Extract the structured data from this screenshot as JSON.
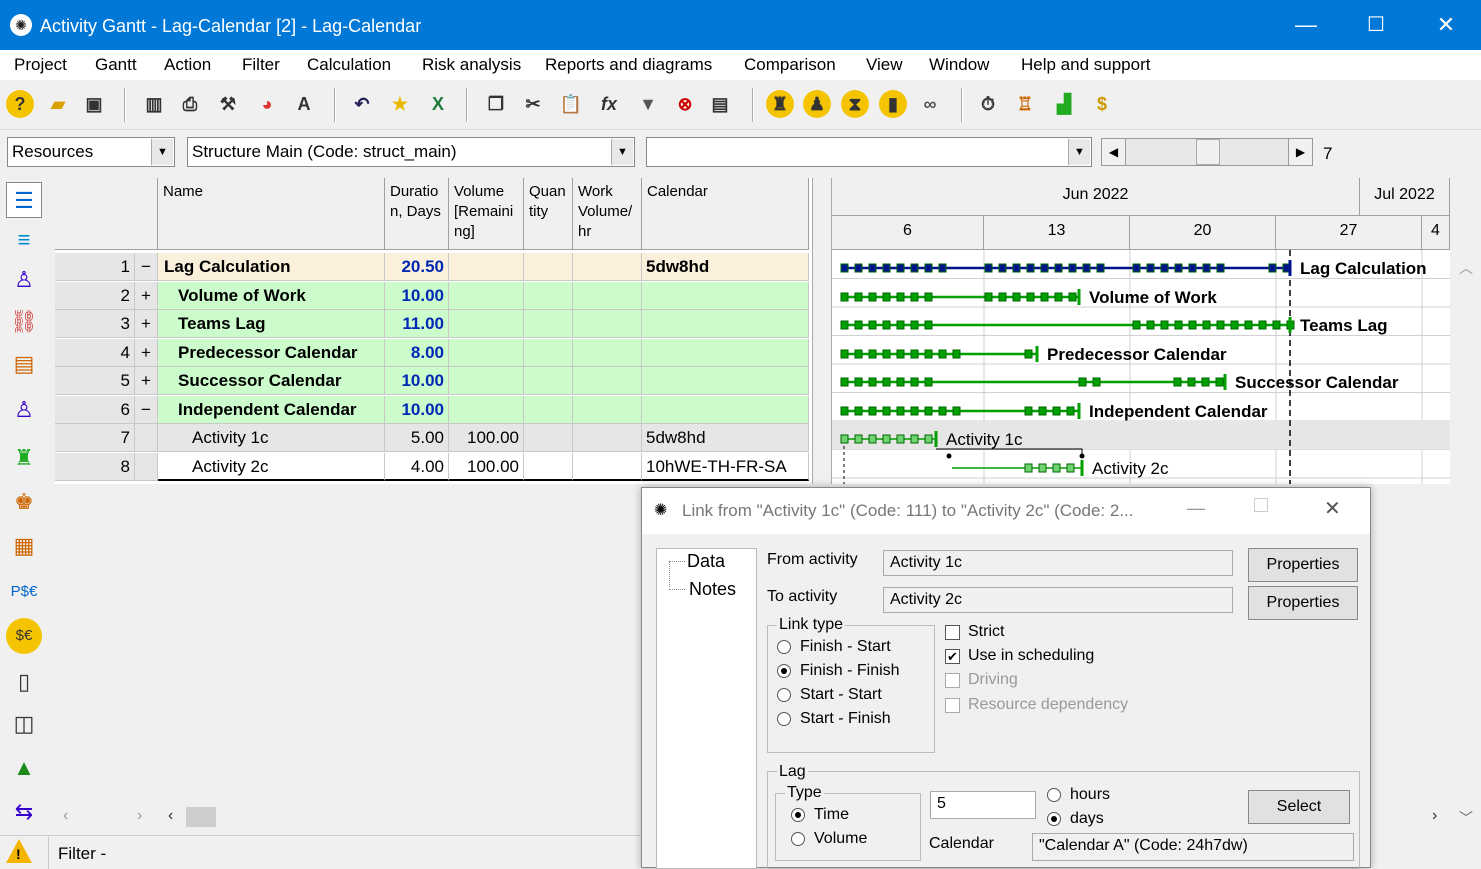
{
  "window": {
    "title": "Activity Gantt - Lag-Calendar [2] - Lag-Calendar",
    "minimize": "—",
    "maximize": "☐",
    "close": "✕"
  },
  "menu": [
    "Project",
    "Gantt",
    "Action",
    "Filter",
    "Calculation",
    "Risk analysis",
    "Reports and diagrams",
    "Comparison",
    "View",
    "Window",
    "Help and support"
  ],
  "toolbar": {
    "icons": [
      "help-icon",
      "open-folder-icon",
      "save-icon",
      "table-icon",
      "print-icon",
      "tools-icon",
      "chart-icon",
      "font-icon",
      "undo-icon",
      "star-icon",
      "excel-icon",
      "copy-icon",
      "cut-icon",
      "paste-icon",
      "formula-icon",
      "filter-icon",
      "filter-clear-icon",
      "columns-icon",
      "person-run-icon",
      "person-icon",
      "person-clock-icon",
      "person-settings-icon",
      "link-icon",
      "calc-time-icon",
      "resource-level-icon",
      "cost-icon",
      "money-icon"
    ]
  },
  "selectors": {
    "view_combo": "Resources",
    "structure_combo": "Structure Main (Code: struct_main)",
    "third_combo": "",
    "scroll_value": "7"
  },
  "grid": {
    "headers": {
      "name": "Name",
      "duration": "Duratio n, Days",
      "volume": "Volume [Remaini ng]",
      "quantity": "Quan tity",
      "work": "Work Volume/ hr",
      "calendar": "Calendar"
    },
    "rows": [
      {
        "n": "1",
        "toggle": "−",
        "name": "Lag Calculation",
        "duration": "20.50",
        "volume": "",
        "calendar": "5dw8hd"
      },
      {
        "n": "2",
        "toggle": "+",
        "name": "Volume of Work",
        "duration": "10.00",
        "volume": "",
        "calendar": ""
      },
      {
        "n": "3",
        "toggle": "+",
        "name": "Teams Lag",
        "duration": "11.00",
        "volume": "",
        "calendar": ""
      },
      {
        "n": "4",
        "toggle": "+",
        "name": "Predecessor Calendar",
        "duration": "8.00",
        "volume": "",
        "calendar": ""
      },
      {
        "n": "5",
        "toggle": "+",
        "name": "Successor Calendar",
        "duration": "10.00",
        "volume": "",
        "calendar": ""
      },
      {
        "n": "6",
        "toggle": "−",
        "name": "Independent Calendar",
        "duration": "10.00",
        "volume": "",
        "calendar": ""
      },
      {
        "n": "7",
        "toggle": "",
        "name": "Activity 1c",
        "duration": "5.00",
        "volume": "100.00",
        "calendar": "5dw8hd"
      },
      {
        "n": "8",
        "toggle": "",
        "name": "Activity 2c",
        "duration": "4.00",
        "volume": "100.00",
        "calendar": "10hWE-TH-FR-SA"
      }
    ]
  },
  "gantt": {
    "months": [
      "Jun 2022",
      "Jul 2022"
    ],
    "days": [
      "6",
      "13",
      "20",
      "27",
      "4"
    ],
    "bars": [
      {
        "label": "Lag Calculation",
        "color": "#00148c"
      },
      {
        "label": "Volume of Work",
        "color": "#00a000"
      },
      {
        "label": "Teams Lag",
        "color": "#00a000"
      },
      {
        "label": "Predecessor Calendar",
        "color": "#00a000"
      },
      {
        "label": "Successor Calendar",
        "color": "#00a000"
      },
      {
        "label": "Independent Calendar",
        "color": "#00a000"
      },
      {
        "label": "Activity 1c",
        "color": "#00a000"
      },
      {
        "label": "Activity 2c",
        "color": "#00a000"
      }
    ]
  },
  "dialog": {
    "title": "Link from \"Activity 1c\" (Code: 111) to \"Activity 2c\" (Code: 2...",
    "tree": [
      "Data",
      "Notes"
    ],
    "from_label": "From activity",
    "from_value": "Activity 1c",
    "to_label": "To activity",
    "to_value": "Activity 2c",
    "properties_btn": "Properties",
    "link_type_title": "Link type",
    "link_types": [
      "Finish - Start",
      "Finish - Finish",
      "Start - Start",
      "Start - Finish"
    ],
    "link_type_selected": "Finish - Finish",
    "checks": [
      {
        "label": "Strict",
        "checked": false,
        "enabled": true
      },
      {
        "label": "Use in scheduling",
        "checked": true,
        "enabled": true
      },
      {
        "label": "Driving",
        "checked": false,
        "enabled": false
      },
      {
        "label": "Resource dependency",
        "checked": false,
        "enabled": false
      }
    ],
    "lag_title": "Lag",
    "type_title": "Type",
    "type_options": [
      "Time",
      "Volume"
    ],
    "type_selected": "Time",
    "lag_value": "5",
    "unit_options": [
      "hours",
      "days"
    ],
    "unit_selected": "days",
    "select_btn": "Select",
    "calendar_label": "Calendar",
    "calendar_value": "\"Calendar A\" (Code: 24h7dw)"
  },
  "status": {
    "filter_text": "Filter -"
  }
}
